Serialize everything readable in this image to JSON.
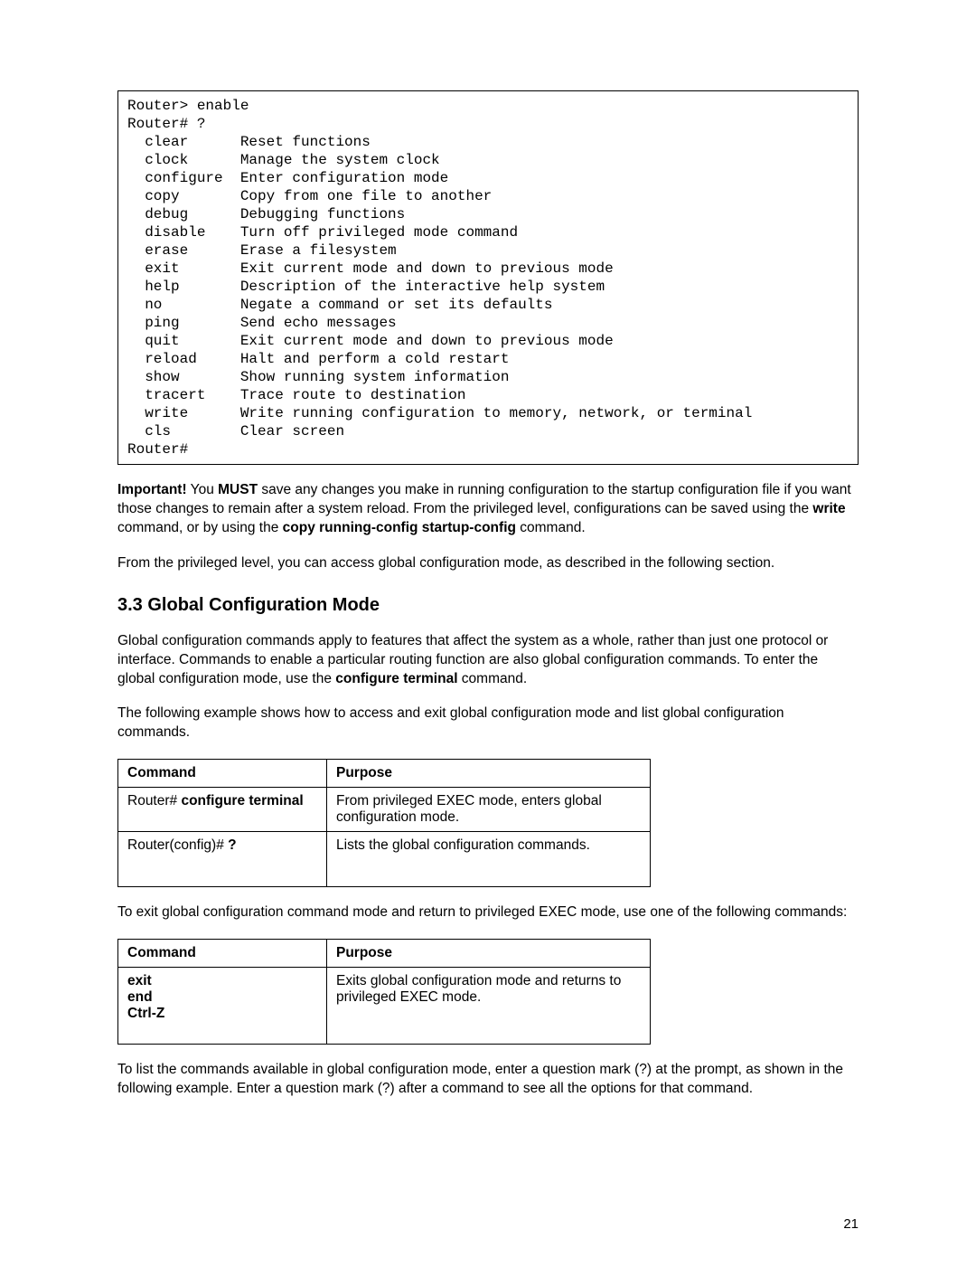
{
  "code_block": "Router> enable\nRouter# ?\n  clear      Reset functions\n  clock      Manage the system clock\n  configure  Enter configuration mode\n  copy       Copy from one file to another\n  debug      Debugging functions\n  disable    Turn off privileged mode command\n  erase      Erase a filesystem\n  exit       Exit current mode and down to previous mode\n  help       Description of the interactive help system\n  no         Negate a command or set its defaults\n  ping       Send echo messages\n  quit       Exit current mode and down to previous mode\n  reload     Halt and perform a cold restart\n  show       Show running system information\n  tracert    Trace route to destination\n  write      Write running configuration to memory, network, or terminal\n  cls        Clear screen\nRouter#",
  "important": {
    "prefix": "Important!",
    "part1": " You ",
    "must": "MUST",
    "part2": " save any changes you make in running configuration to the startup configuration file if you want those changes to remain after a system reload. From the privileged level, configurations can be saved using the ",
    "cmd1": "write",
    "part3": " command, or by using the ",
    "cmd2": "copy running-config startup-config",
    "part4": " command."
  },
  "para2": "From the privileged level, you can access global configuration mode, as described in the following section.",
  "section_heading": "3.3 Global Configuration Mode",
  "para3": {
    "part1": "Global configuration commands apply to features that affect the system as a whole, rather than just one protocol or interface. Commands to enable a particular routing function are also global configuration commands. To enter the global configuration mode, use the ",
    "cmd": "configure terminal",
    "part2": " command."
  },
  "para4": "The following example shows how to access and exit global configuration mode and list global configuration commands.",
  "table1": {
    "headers": {
      "command": "Command",
      "purpose": "Purpose"
    },
    "rows": [
      {
        "cmd_prefix": "Router# ",
        "cmd_bold": "configure terminal",
        "purpose": "From privileged EXEC mode, enters global configuration mode."
      },
      {
        "cmd_prefix": "Router(config)# ",
        "cmd_bold": "?",
        "purpose": "Lists the global configuration commands."
      }
    ]
  },
  "para5": "To exit global configuration command mode and return to privileged EXEC mode, use one of the following commands:",
  "table2": {
    "headers": {
      "command": "Command",
      "purpose": "Purpose"
    },
    "row": {
      "cmd_line1": "exit",
      "cmd_line2": "end",
      "cmd_line3": "Ctrl-Z",
      "purpose": "Exits global configuration mode and returns to privileged EXEC mode."
    }
  },
  "para6": "To list the commands available in global configuration mode, enter a question mark (?) at the prompt, as shown in the following example. Enter a question mark (?) after a command to see all the options for that command.",
  "page_number": "21"
}
